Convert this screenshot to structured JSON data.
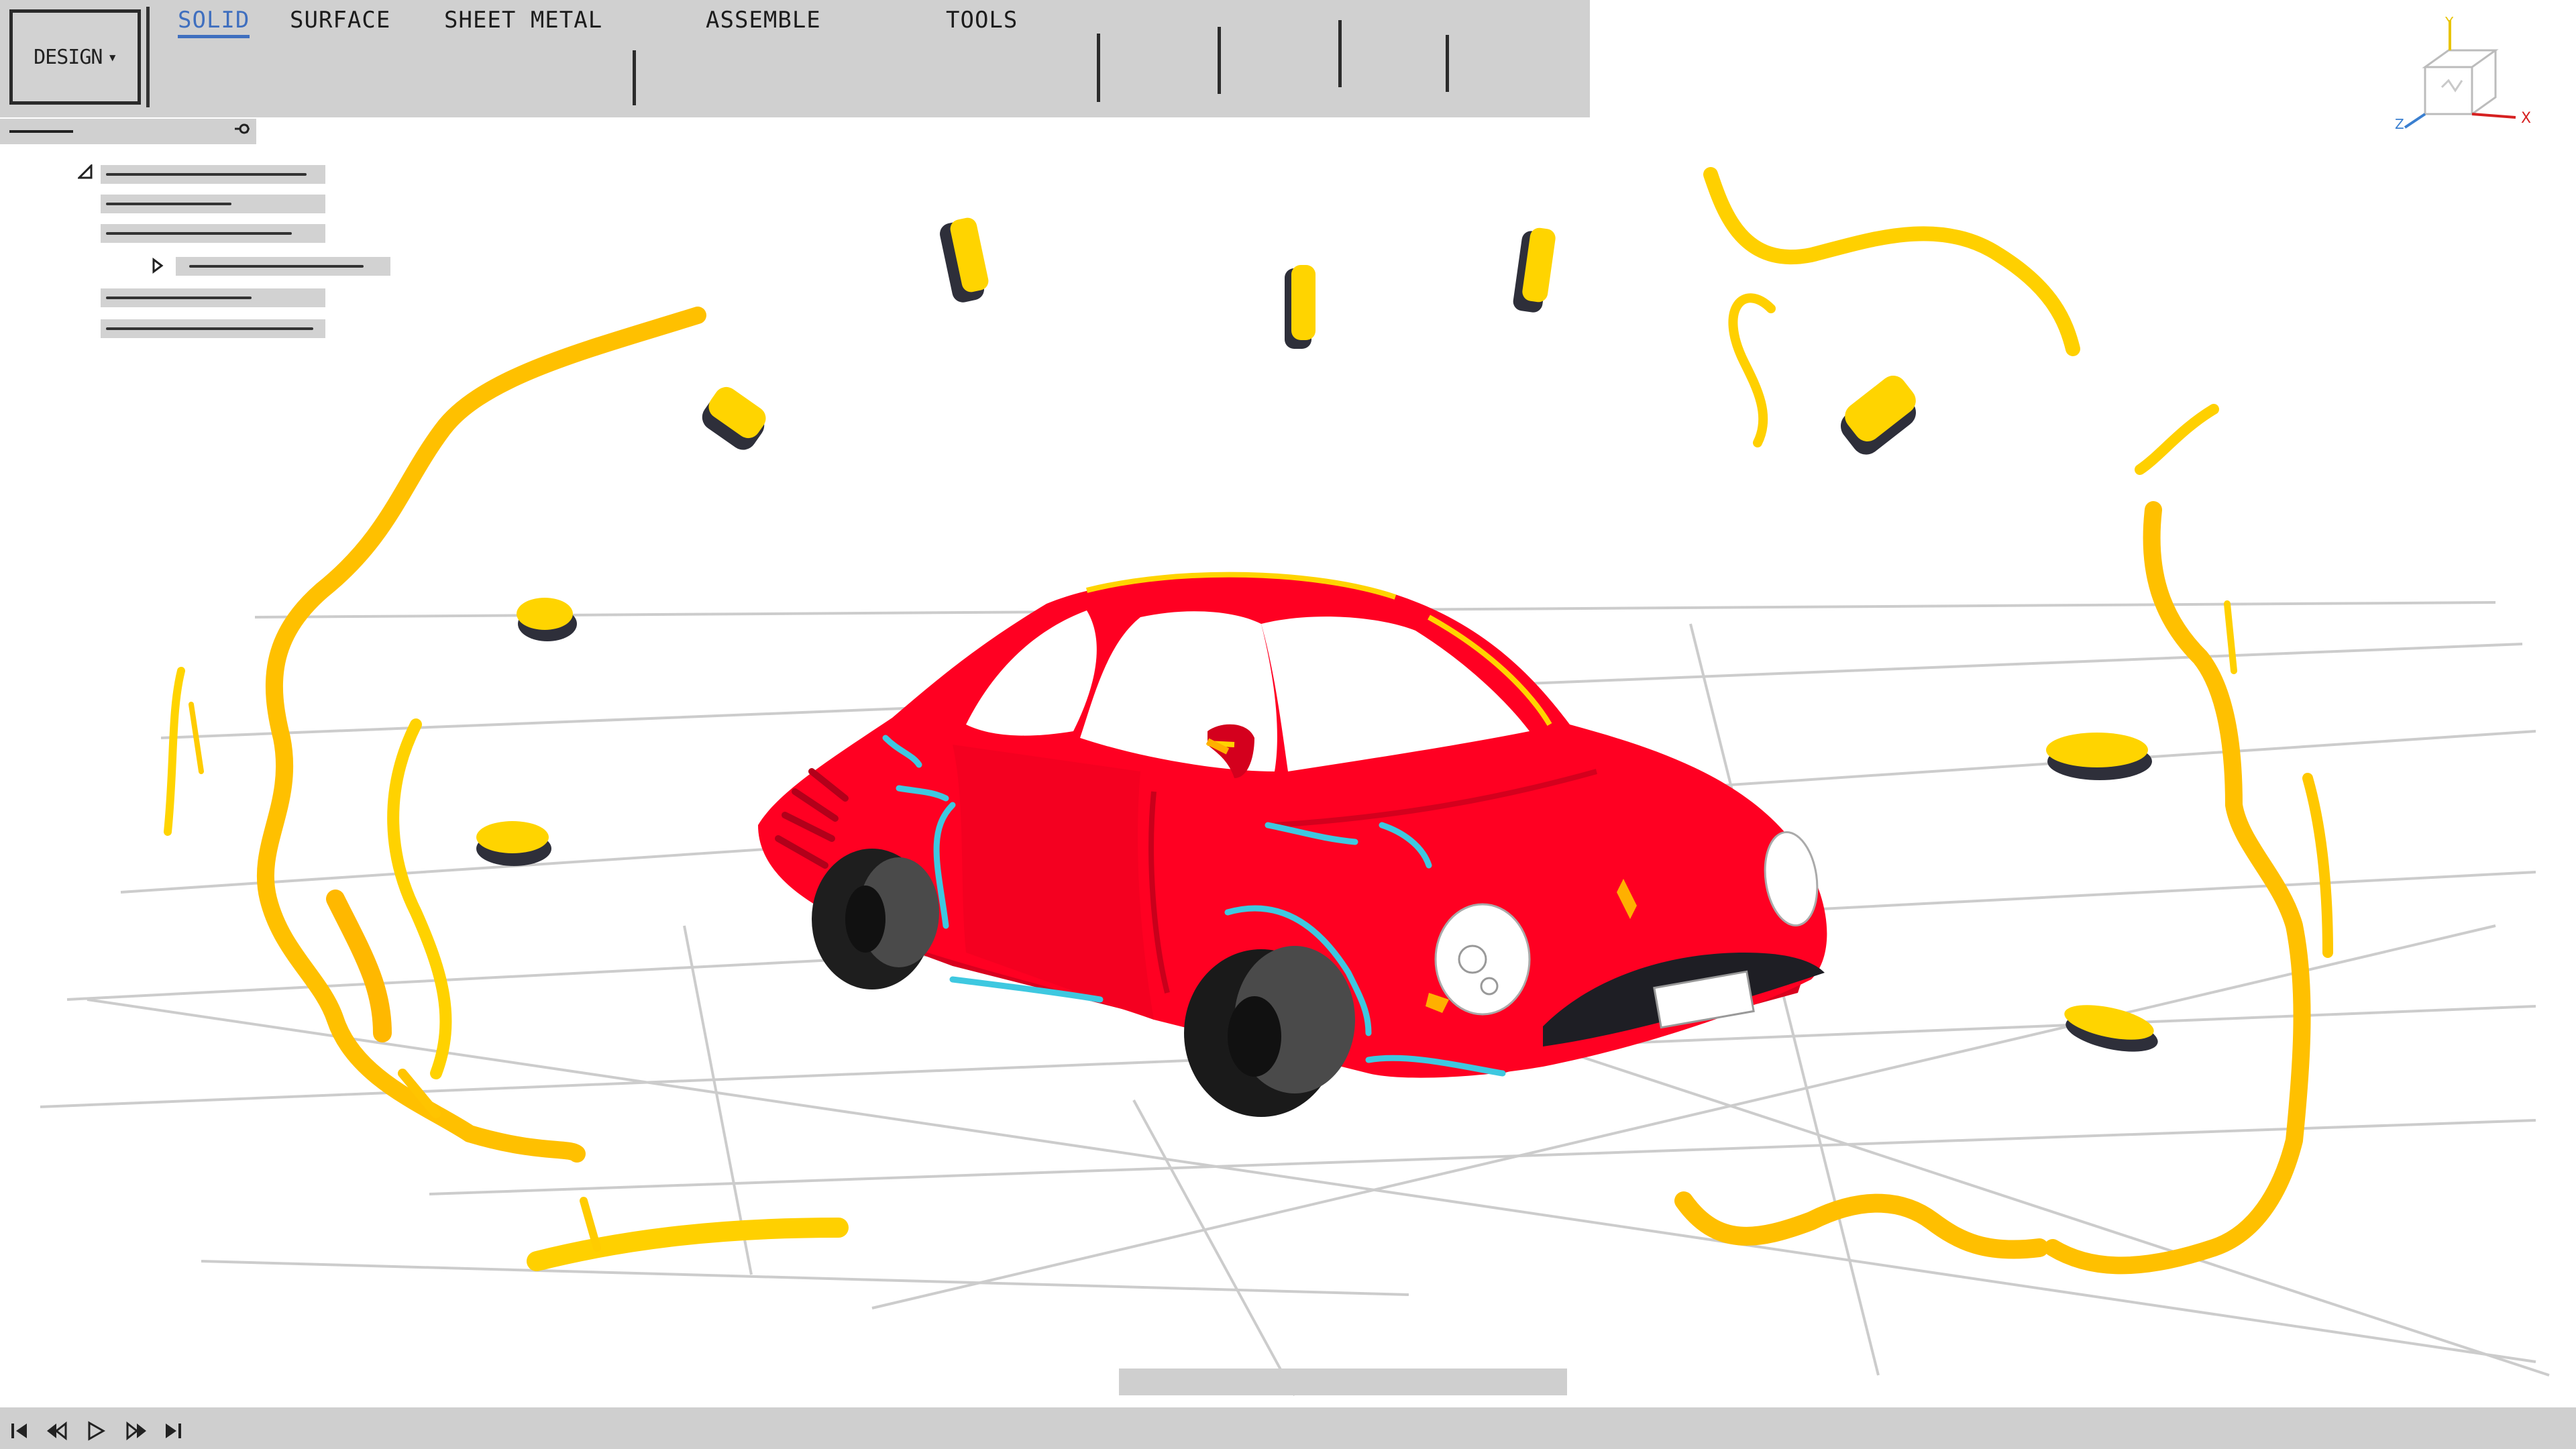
{
  "toolbar": {
    "workspace_label": "DESIGN",
    "workspace_caret": "▾",
    "tabs": [
      {
        "label": "SOLID",
        "active": true
      },
      {
        "label": "SURFACE",
        "active": false
      },
      {
        "label": "SHEET METAL",
        "active": false
      },
      {
        "label": "ASSEMBLE",
        "active": false
      },
      {
        "label": "TOOLS",
        "active": false
      }
    ]
  },
  "browser": {
    "dock_icon": "pin-icon",
    "collapse_icon": "triangle-down-icon",
    "expand_icon": "triangle-right-icon"
  },
  "viewcube": {
    "axes": {
      "y": "Y",
      "x": "X",
      "z": "Z"
    },
    "colors": {
      "y": "#e8c400",
      "x": "#d62020",
      "z": "#3a7fd0"
    }
  },
  "timeline": {
    "controls": [
      "skip-to-start-icon",
      "step-back-icon",
      "play-icon",
      "step-forward-icon",
      "skip-to-end-icon"
    ]
  },
  "colors": {
    "toolbar_bg": "#d0d0d0",
    "accent": "#3f6fbf",
    "car_body": "#ff0022",
    "speed_lines": "#ffc400",
    "grid": "#cfcfcf"
  }
}
